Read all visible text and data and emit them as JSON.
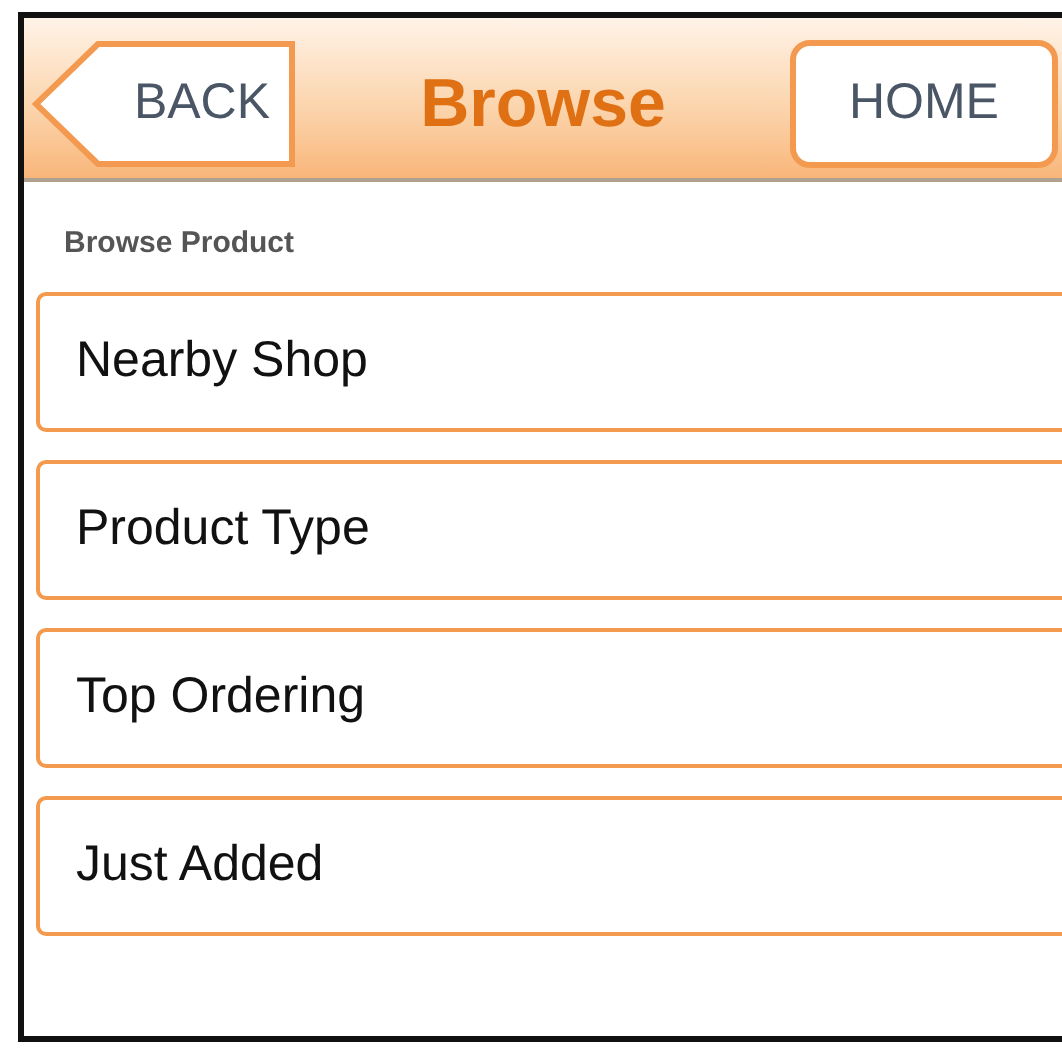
{
  "header": {
    "back_button": "BACK",
    "title": "Browse",
    "home_button": "HOME"
  },
  "section_label": "Browse Product",
  "menu_items": [
    {
      "label": "Nearby Shop"
    },
    {
      "label": "Product Type"
    },
    {
      "label": "Top Ordering"
    },
    {
      "label": "Just Added"
    }
  ]
}
